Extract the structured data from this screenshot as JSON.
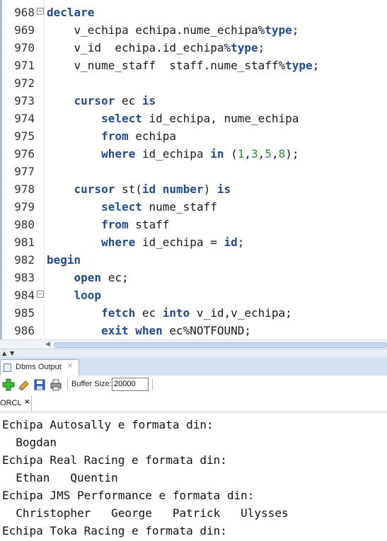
{
  "editor": {
    "lines": [
      {
        "num": "968",
        "fold": "⊟",
        "tokens": [
          {
            "t": "declare",
            "k": "kw"
          }
        ]
      },
      {
        "num": "969",
        "fold": "",
        "tokens": [
          {
            "t": "    v_echipa echipa.nume_echipa%",
            "k": ""
          },
          {
            "t": "type",
            "k": "kw"
          },
          {
            "t": ";",
            "k": ""
          }
        ]
      },
      {
        "num": "970",
        "fold": "",
        "tokens": [
          {
            "t": "    v_id  echipa.id_echipa%",
            "k": ""
          },
          {
            "t": "type",
            "k": "kw"
          },
          {
            "t": ";",
            "k": ""
          }
        ]
      },
      {
        "num": "971",
        "fold": "",
        "tokens": [
          {
            "t": "    v_nume_staff  staff.nume_staff%",
            "k": ""
          },
          {
            "t": "type",
            "k": "kw"
          },
          {
            "t": ";",
            "k": ""
          }
        ]
      },
      {
        "num": "972",
        "fold": "",
        "tokens": []
      },
      {
        "num": "973",
        "fold": "",
        "tokens": [
          {
            "t": "    ",
            "k": ""
          },
          {
            "t": "cursor",
            "k": "kw"
          },
          {
            "t": " ec ",
            "k": ""
          },
          {
            "t": "is",
            "k": "kw"
          }
        ]
      },
      {
        "num": "974",
        "fold": "",
        "tokens": [
          {
            "t": "        ",
            "k": ""
          },
          {
            "t": "select",
            "k": "kw"
          },
          {
            "t": " id_echipa, nume_echipa",
            "k": ""
          }
        ]
      },
      {
        "num": "975",
        "fold": "",
        "tokens": [
          {
            "t": "        ",
            "k": ""
          },
          {
            "t": "from",
            "k": "kw"
          },
          {
            "t": " echipa",
            "k": ""
          }
        ]
      },
      {
        "num": "976",
        "fold": "",
        "tokens": [
          {
            "t": "        ",
            "k": ""
          },
          {
            "t": "where",
            "k": "kw"
          },
          {
            "t": " id_echipa ",
            "k": ""
          },
          {
            "t": "in",
            "k": "kw"
          },
          {
            "t": " (",
            "k": ""
          },
          {
            "t": "1",
            "k": "num"
          },
          {
            "t": ",",
            "k": ""
          },
          {
            "t": "3",
            "k": "num"
          },
          {
            "t": ",",
            "k": ""
          },
          {
            "t": "5",
            "k": "num"
          },
          {
            "t": ",",
            "k": ""
          },
          {
            "t": "8",
            "k": "num"
          },
          {
            "t": ");",
            "k": ""
          }
        ]
      },
      {
        "num": "977",
        "fold": "",
        "tokens": []
      },
      {
        "num": "978",
        "fold": "",
        "tokens": [
          {
            "t": "    ",
            "k": ""
          },
          {
            "t": "cursor",
            "k": "kw"
          },
          {
            "t": " st(",
            "k": ""
          },
          {
            "t": "id",
            "k": "kw"
          },
          {
            "t": " ",
            "k": ""
          },
          {
            "t": "number",
            "k": "kw"
          },
          {
            "t": ") ",
            "k": ""
          },
          {
            "t": "is",
            "k": "kw"
          }
        ]
      },
      {
        "num": "979",
        "fold": "",
        "tokens": [
          {
            "t": "        ",
            "k": ""
          },
          {
            "t": "select",
            "k": "kw"
          },
          {
            "t": " nume_staff",
            "k": ""
          }
        ]
      },
      {
        "num": "980",
        "fold": "",
        "tokens": [
          {
            "t": "        ",
            "k": ""
          },
          {
            "t": "from",
            "k": "kw"
          },
          {
            "t": " staff",
            "k": ""
          }
        ]
      },
      {
        "num": "981",
        "fold": "",
        "tokens": [
          {
            "t": "        ",
            "k": ""
          },
          {
            "t": "where",
            "k": "kw"
          },
          {
            "t": " id_echipa = ",
            "k": ""
          },
          {
            "t": "id",
            "k": "kw"
          },
          {
            "t": ";",
            "k": ""
          }
        ]
      },
      {
        "num": "982",
        "fold": "",
        "tokens": [
          {
            "t": "begin",
            "k": "kw"
          }
        ]
      },
      {
        "num": "983",
        "fold": "",
        "tokens": [
          {
            "t": "    ",
            "k": ""
          },
          {
            "t": "open",
            "k": "kw"
          },
          {
            "t": " ec;",
            "k": ""
          }
        ]
      },
      {
        "num": "984",
        "fold": "⊟",
        "tokens": [
          {
            "t": "    ",
            "k": ""
          },
          {
            "t": "loop",
            "k": "kw"
          }
        ]
      },
      {
        "num": "985",
        "fold": "",
        "tokens": [
          {
            "t": "        ",
            "k": ""
          },
          {
            "t": "fetch",
            "k": "kw"
          },
          {
            "t": " ec ",
            "k": ""
          },
          {
            "t": "into",
            "k": "kw"
          },
          {
            "t": " v_id,v_echipa;",
            "k": ""
          }
        ]
      },
      {
        "num": "986",
        "fold": "",
        "tokens": [
          {
            "t": "        ",
            "k": ""
          },
          {
            "t": "exit",
            "k": "kw"
          },
          {
            "t": " ",
            "k": ""
          },
          {
            "t": "when",
            "k": "kw"
          },
          {
            "t": " ec%NOTFOUND;",
            "k": ""
          }
        ]
      }
    ]
  },
  "panel": {
    "tab_label": "Dbms Output",
    "tab_close": "×",
    "toolbar": {
      "buffer_label": "Buffer Size:",
      "buffer_value": "20000"
    },
    "connection_tab": {
      "label": "ORCL",
      "close": "×"
    }
  },
  "output": {
    "lines": [
      "Echipa Autosally e formata din:",
      "  Bogdan",
      "Echipa Real Racing e formata din:",
      "  Ethan   Quentin",
      "Echipa JMS Performance e formata din:",
      "  Christopher   George   Patrick   Ulysses",
      "Echipa Toka Racing e formata din:"
    ]
  }
}
